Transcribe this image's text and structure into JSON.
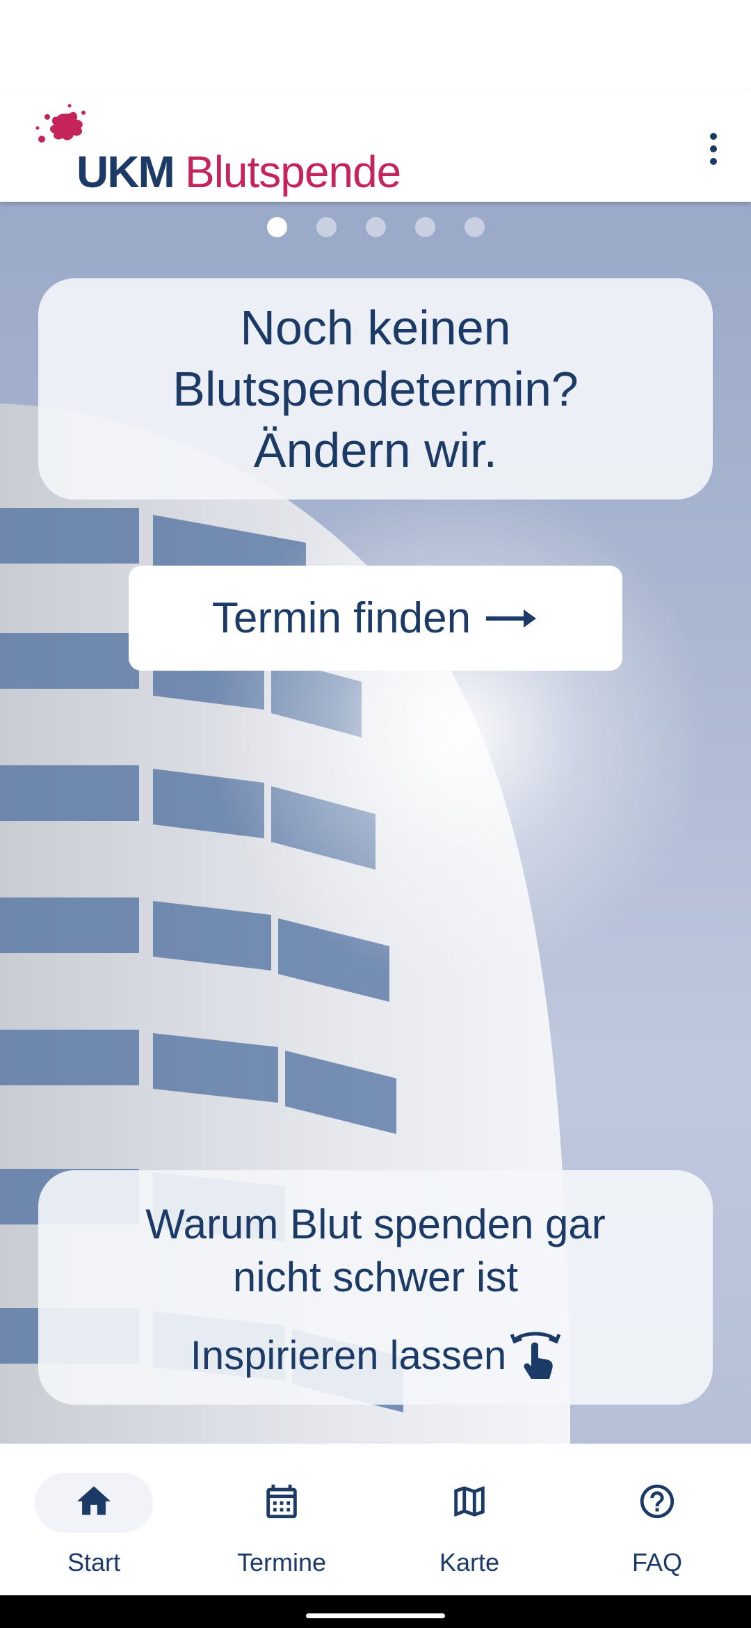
{
  "app": {
    "logo_primary": "UKM",
    "logo_secondary": "Blutspende",
    "brand_navy": "#1c3a66",
    "brand_red": "#c4245a"
  },
  "pager": {
    "count": 5,
    "active_index": 0
  },
  "hero_card": {
    "text": "Noch keinen\nBlutspendetermin?\nÄndern wir."
  },
  "find_button": {
    "label": "Termin finden",
    "icon": "arrow-right-icon"
  },
  "info_card": {
    "title": "Warum Blut spenden gar\nnicht schwer ist",
    "action_label": "Inspirieren lassen",
    "action_icon": "swipe-gesture-icon"
  },
  "bottom_nav": {
    "items": [
      {
        "label": "Start",
        "icon": "home-icon",
        "selected": true
      },
      {
        "label": "Termine",
        "icon": "calendar-icon",
        "selected": false
      },
      {
        "label": "Karte",
        "icon": "map-icon",
        "selected": false
      },
      {
        "label": "FAQ",
        "icon": "help-circle-icon",
        "selected": false
      }
    ]
  }
}
